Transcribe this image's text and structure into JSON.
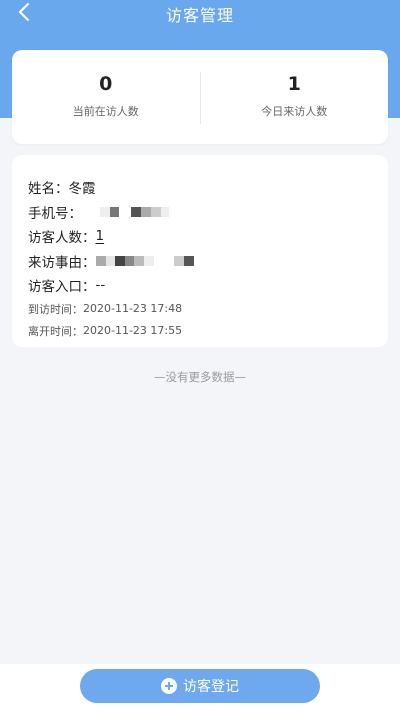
{
  "header": {
    "title": "访客管理",
    "background_color": "#69a8ec"
  },
  "stats": [
    {
      "value": "0",
      "label": "当前在访人数"
    },
    {
      "value": "1",
      "label": "今日来访人数"
    }
  ],
  "visitor": {
    "name_label": "姓名：",
    "name_value": "冬霞",
    "phone_label": "手机号：",
    "count_label": "访客人数：",
    "count_value": "1",
    "reason_label": "来访事由：",
    "entrance_label": "访客入口：",
    "entrance_value": "--",
    "arrive_label": "到访时间：",
    "arrive_value": "2020-11-23 17:48",
    "leave_label": "离开时间：",
    "leave_value": "2020-11-23 17:55"
  },
  "list_footer": "—没有更多数据—",
  "register_button": {
    "label": "访客登记",
    "color": "#6ea8ee"
  }
}
